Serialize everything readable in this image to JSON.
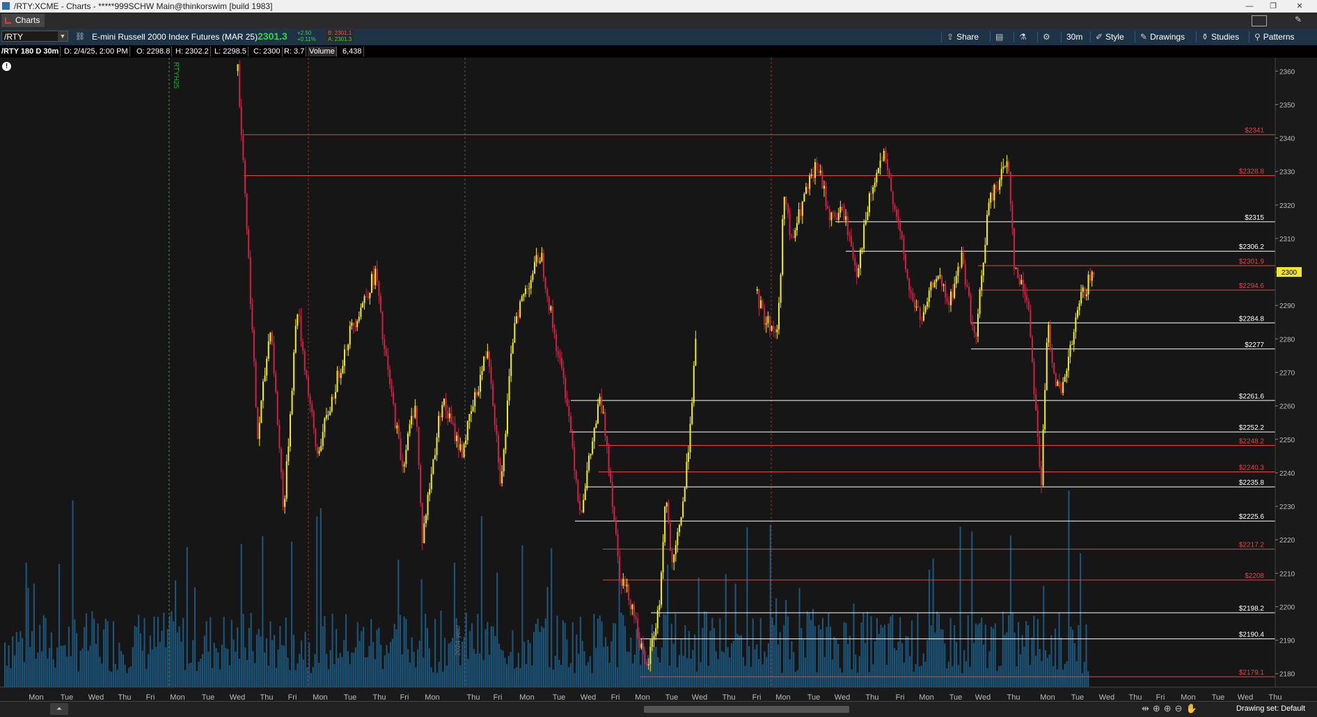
{
  "window": {
    "title": "/RTY:XCME - Charts - *****999SCHW Main@thinkorswim [build 1983]",
    "controls": [
      "—",
      "❐",
      "✕"
    ]
  },
  "tab": {
    "label": "Charts"
  },
  "toolbar": {
    "symbol": "/RTY",
    "description": "E-mini Russell 2000 Index Futures (MAR 25)",
    "last": "2301.3",
    "change": "+2.50",
    "change_pct": "+0.11%",
    "bid": "B: 2301.1",
    "ask": "A: 2301.3",
    "share": "Share",
    "timeframe": "30m",
    "style": "Style",
    "drawings": "Drawings",
    "studies": "Studies",
    "patterns": "Patterns"
  },
  "header": {
    "symbol_period": "/RTY 180 D 30m",
    "date": "D: 2/4/25, 2:00 PM",
    "open": "O: 2298.8",
    "high": "H: 2302.2",
    "low": "L: 2298.5",
    "close": "C: 2300",
    "range": "R: 3.7",
    "volume_label": "Volume",
    "volume_value": "6,438"
  },
  "info_icon": "!",
  "chart_data": {
    "type": "candlestick",
    "title": "",
    "ylabel": "",
    "ylim": [
      2176,
      2364
    ],
    "price_ticks": [
      2180,
      2190,
      2200,
      2210,
      2220,
      2230,
      2240,
      2250,
      2260,
      2270,
      2280,
      2290,
      2300,
      2310,
      2320,
      2330,
      2340,
      2350,
      2360
    ],
    "x_labels": [
      "Mon",
      "Tue",
      "Wed",
      "Thu",
      "Fri",
      "Mon",
      "Tue",
      "Wed",
      "Thu",
      "Fri",
      "Mon",
      "Tue",
      "Thu",
      "Fri",
      "Mon",
      "Thu",
      "Fri",
      "Mon",
      "Tue",
      "Wed",
      "Fri",
      "Mon",
      "Tue",
      "Wed",
      "Thu",
      "Fri",
      "Mon",
      "Tue",
      "Wed",
      "Thu",
      "Fri",
      "Mon",
      "Tue",
      "Wed",
      "Thu",
      "Mon",
      "Tue",
      "Wed",
      "Thu",
      "Fri",
      "Mon",
      "Tue",
      "Wed",
      "Thu"
    ],
    "last_price_tag": "2300",
    "up_color": "#f5ef1f",
    "down_color": "#d41f44",
    "volume_color": "#1d5f8a",
    "period_markers": [
      {
        "label": "RTYH25",
        "color": "#1fae3a"
      },
      {
        "label": "2024 year",
        "color": "#888888"
      }
    ],
    "levels": [
      {
        "price": 2341,
        "label": "$2341",
        "color": "#e04646"
      },
      {
        "price": 2328.8,
        "label": "$2328.8",
        "color": "#e04646"
      },
      {
        "price": 2315,
        "label": "$2315",
        "color": "#ffffff"
      },
      {
        "price": 2306.2,
        "label": "$2306.2",
        "color": "#ffffff"
      },
      {
        "price": 2301.9,
        "label": "$2301.9",
        "color": "#e04646"
      },
      {
        "price": 2294.6,
        "label": "$2294.6",
        "color": "#e04646"
      },
      {
        "price": 2284.8,
        "label": "$2284.8",
        "color": "#ffffff"
      },
      {
        "price": 2277,
        "label": "$2277",
        "color": "#ffffff"
      },
      {
        "price": 2261.6,
        "label": "$2261.6",
        "color": "#ffffff"
      },
      {
        "price": 2252.2,
        "label": "$2252.2",
        "color": "#ffffff"
      },
      {
        "price": 2248.2,
        "label": "$2248.2",
        "color": "#e04646"
      },
      {
        "price": 2240.3,
        "label": "$2240.3",
        "color": "#e04646"
      },
      {
        "price": 2235.8,
        "label": "$2235.8",
        "color": "#ffffff"
      },
      {
        "price": 2225.6,
        "label": "$2225.6",
        "color": "#ffffff"
      },
      {
        "price": 2217.2,
        "label": "$2217.2",
        "color": "#e04646"
      },
      {
        "price": 2208,
        "label": "$2208",
        "color": "#e04646"
      },
      {
        "price": 2198.2,
        "label": "$2198.2",
        "color": "#ffffff"
      },
      {
        "price": 2190.4,
        "label": "$2190.4",
        "color": "#ffffff"
      },
      {
        "price": 2179.1,
        "label": "$2179.1",
        "color": "#e04646"
      }
    ],
    "path_keypoints": [
      [
        0.18,
        2360
      ],
      [
        0.185,
        2328
      ],
      [
        0.19,
        2290
      ],
      [
        0.195,
        2250
      ],
      [
        0.205,
        2285
      ],
      [
        0.215,
        2228
      ],
      [
        0.225,
        2290
      ],
      [
        0.24,
        2245
      ],
      [
        0.265,
        2282
      ],
      [
        0.285,
        2300
      ],
      [
        0.29,
        2280
      ],
      [
        0.305,
        2242
      ],
      [
        0.315,
        2262
      ],
      [
        0.32,
        2220
      ],
      [
        0.335,
        2262
      ],
      [
        0.35,
        2246
      ],
      [
        0.37,
        2278
      ],
      [
        0.38,
        2236
      ],
      [
        0.39,
        2286
      ],
      [
        0.4,
        2296
      ],
      [
        0.41,
        2306
      ],
      [
        0.42,
        2282
      ],
      [
        0.43,
        2262
      ],
      [
        0.44,
        2228
      ],
      [
        0.455,
        2262
      ],
      [
        0.46,
        2250
      ],
      [
        0.47,
        2210
      ],
      [
        0.48,
        2200
      ],
      [
        0.49,
        2180
      ],
      [
        0.5,
        2200
      ],
      [
        0.505,
        2234
      ],
      [
        0.51,
        2210
      ],
      [
        0.52,
        2237
      ],
      [
        0.53,
        2290
      ],
      [
        0.535,
        2266
      ],
      [
        0.545,
        2280
      ],
      [
        0.55,
        2264
      ],
      [
        0.56,
        2278
      ],
      [
        0.57,
        2298
      ],
      [
        0.58,
        2286
      ],
      [
        0.59,
        2282
      ],
      [
        0.595,
        2325
      ],
      [
        0.6,
        2308
      ],
      [
        0.61,
        2322
      ],
      [
        0.62,
        2332
      ],
      [
        0.63,
        2316
      ],
      [
        0.64,
        2318
      ],
      [
        0.65,
        2300
      ],
      [
        0.66,
        2322
      ],
      [
        0.67,
        2335
      ],
      [
        0.68,
        2318
      ],
      [
        0.69,
        2294
      ],
      [
        0.7,
        2285
      ],
      [
        0.71,
        2300
      ],
      [
        0.72,
        2290
      ],
      [
        0.73,
        2305
      ],
      [
        0.74,
        2278
      ],
      [
        0.75,
        2320
      ],
      [
        0.765,
        2334
      ],
      [
        0.77,
        2300
      ],
      [
        0.78,
        2292
      ],
      [
        0.79,
        2236
      ],
      [
        0.795,
        2285
      ],
      [
        0.8,
        2270
      ],
      [
        0.805,
        2262
      ],
      [
        0.815,
        2282
      ],
      [
        0.82,
        2292
      ],
      [
        0.83,
        2300
      ]
    ]
  },
  "bottom": {
    "drawing_set": "Drawing set: Default",
    "nav_icons": "⇹⊕⊕⊖✋"
  }
}
